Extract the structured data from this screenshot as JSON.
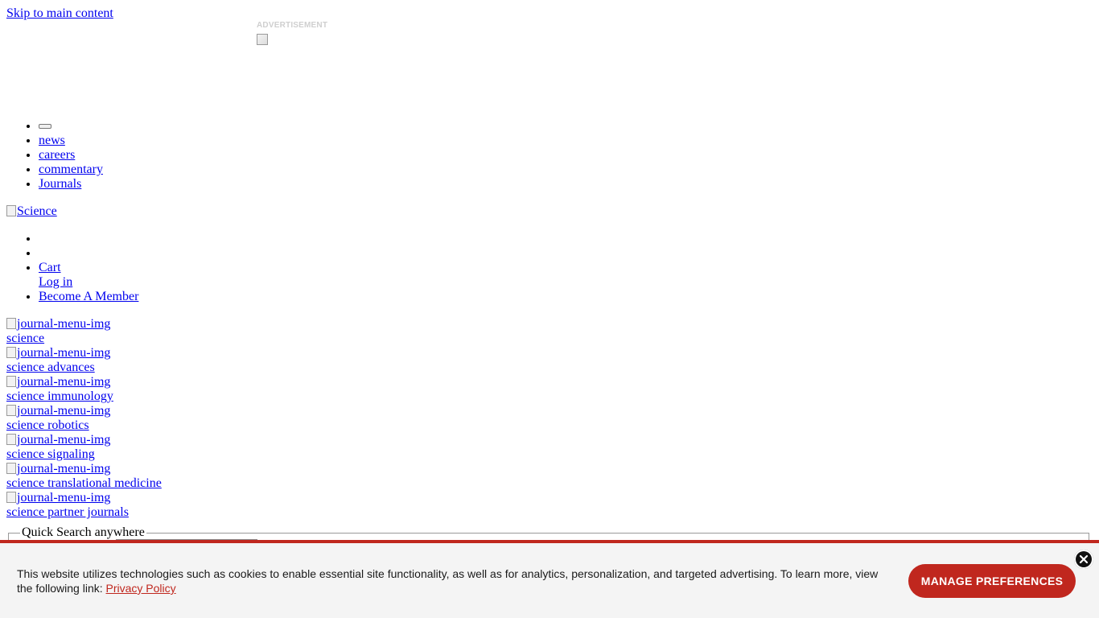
{
  "skip_link": "Skip to main content",
  "advertisement": {
    "label": "ADVERTISEMENT"
  },
  "top_nav": {
    "items": [
      "news",
      "careers",
      "commentary",
      "Journals"
    ]
  },
  "logo": {
    "alt": "Science"
  },
  "user_nav": {
    "cart": "Cart",
    "login": "Log in",
    "become_member": "Become A Member"
  },
  "journals": {
    "image_alt": "journal-menu-img",
    "items": [
      "science",
      "science advances",
      "science immunology",
      "science robotics",
      "science signaling",
      "science translational medicine",
      "science partner journals"
    ]
  },
  "quick_search": {
    "legend": "Quick Search anywhere"
  },
  "cookie_banner": {
    "text": "This website utilizes technologies such as cookies to enable essential site functionality, as well as for analytics, personalization, and targeted advertising. To learn more, view the following link:",
    "link": "Privacy Policy",
    "button": "MANAGE PREFERENCES",
    "accent_color": "#c0271e"
  }
}
